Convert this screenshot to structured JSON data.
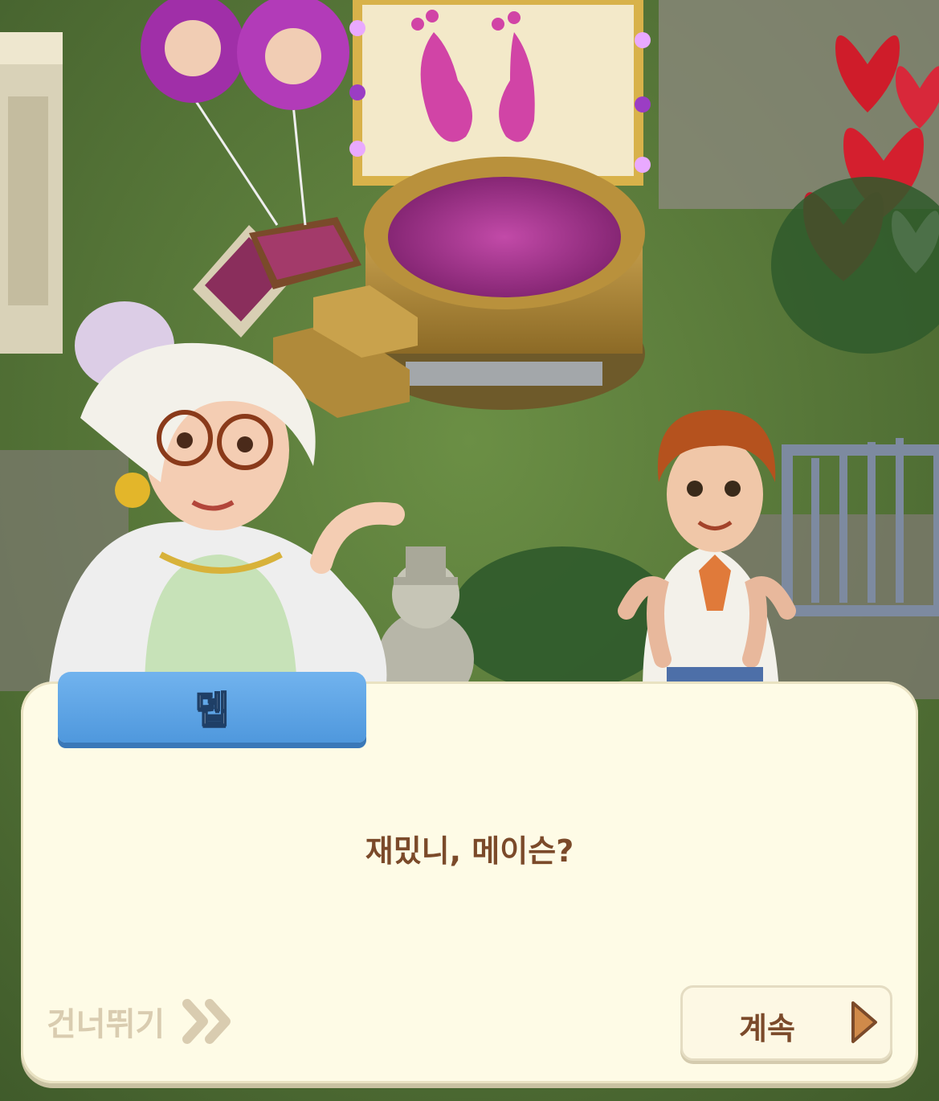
{
  "dialog": {
    "speaker": "뎁",
    "text": "재밌니, 메이슨?",
    "skip_label": "건너뛰기",
    "continue_label": "계속"
  },
  "icons": {
    "skip": "double-chevron-right-icon",
    "continue": "play-triangle-icon"
  },
  "colors": {
    "name_tab": "#5aa3e6",
    "dialog_bg": "#fefbe6",
    "dialog_text": "#7b4a2a",
    "skip_text": "#d9ccb0",
    "continue_triangle": "#d08a4a"
  }
}
